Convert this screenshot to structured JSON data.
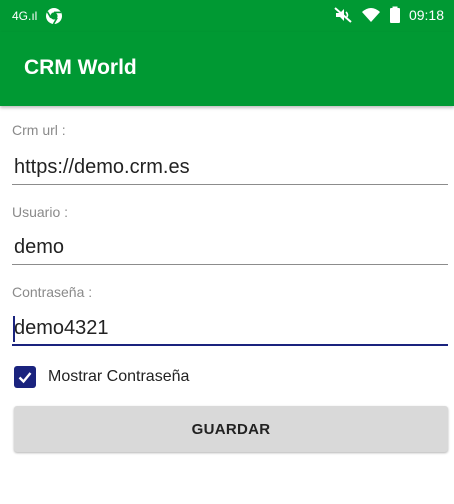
{
  "status_bar": {
    "signal_text": "4G.ıl",
    "app_icon": "chrome-icon",
    "mute_icon": "mute-icon",
    "wifi_icon": "wifi-icon",
    "battery_icon": "battery-icon",
    "time": "09:18",
    "background_color": "#009933"
  },
  "app_bar": {
    "title": "CRM World",
    "background_color": "#009933"
  },
  "form": {
    "crm_url": {
      "label": "Crm url :",
      "value": "https://demo.crm.es"
    },
    "usuario": {
      "label": "Usuario :",
      "value": "demo"
    },
    "contrasena": {
      "label": "Contraseña :",
      "value": "demo4321",
      "focused": true
    },
    "show_password": {
      "label": "Mostrar Contraseña",
      "checked": true
    },
    "save_button": {
      "label": "GUARDAR"
    }
  },
  "accent_color": "#1a237e"
}
